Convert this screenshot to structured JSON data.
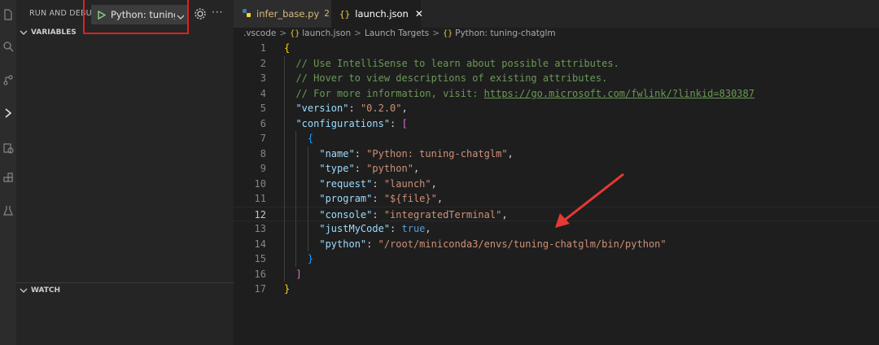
{
  "sidebar": {
    "title": "RUN AND DEBUG",
    "config_label": "Python: tuning-c",
    "sections": {
      "variables": "VARIABLES",
      "watch": "WATCH"
    }
  },
  "tabs": [
    {
      "icon": "python-file-icon",
      "name": "infer_base.py",
      "badge": "2"
    },
    {
      "icon": "json-file-icon",
      "glyph": "{}",
      "name": "launch.json",
      "close": "✕"
    }
  ],
  "breadcrumb": {
    "folder": ".vscode",
    "file": "launch.json",
    "section": "Launch Targets",
    "item": "Python: tuning-chatglm",
    "separator": ">"
  },
  "code": {
    "lines": [
      {
        "n": "1",
        "parts": [
          {
            "t": "{",
            "c": "c-brace"
          }
        ]
      },
      {
        "n": "2",
        "parts": [
          {
            "t": "  // Use IntelliSense to learn about possible attributes.",
            "c": "c-comment"
          }
        ]
      },
      {
        "n": "3",
        "parts": [
          {
            "t": "  // Hover to view descriptions of existing attributes.",
            "c": "c-comment"
          }
        ]
      },
      {
        "n": "4",
        "parts": [
          {
            "t": "  // For more information, visit: ",
            "c": "c-comment"
          },
          {
            "t": "https://go.microsoft.com/fwlink/?linkid=830387",
            "c": "c-link"
          }
        ]
      },
      {
        "n": "5",
        "parts": [
          {
            "t": "  \"version\"",
            "c": "c-key"
          },
          {
            "t": ": ",
            "c": "c-punct"
          },
          {
            "t": "\"0.2.0\"",
            "c": "c-str"
          },
          {
            "t": ",",
            "c": "c-punct"
          }
        ]
      },
      {
        "n": "6",
        "parts": [
          {
            "t": "  \"configurations\"",
            "c": "c-key"
          },
          {
            "t": ": ",
            "c": "c-punct"
          },
          {
            "t": "[",
            "c": "c-bracket"
          }
        ]
      },
      {
        "n": "7",
        "parts": [
          {
            "t": "    ",
            "c": "c-punct"
          },
          {
            "t": "{",
            "c": "c-brace2"
          }
        ]
      },
      {
        "n": "8",
        "parts": [
          {
            "t": "      \"name\"",
            "c": "c-key"
          },
          {
            "t": ": ",
            "c": "c-punct"
          },
          {
            "t": "\"Python: tuning-chatglm\"",
            "c": "c-str"
          },
          {
            "t": ",",
            "c": "c-punct"
          }
        ]
      },
      {
        "n": "9",
        "parts": [
          {
            "t": "      \"type\"",
            "c": "c-key"
          },
          {
            "t": ": ",
            "c": "c-punct"
          },
          {
            "t": "\"python\"",
            "c": "c-str"
          },
          {
            "t": ",",
            "c": "c-punct"
          }
        ]
      },
      {
        "n": "10",
        "parts": [
          {
            "t": "      \"request\"",
            "c": "c-key"
          },
          {
            "t": ": ",
            "c": "c-punct"
          },
          {
            "t": "\"launch\"",
            "c": "c-str"
          },
          {
            "t": ",",
            "c": "c-punct"
          }
        ]
      },
      {
        "n": "11",
        "parts": [
          {
            "t": "      \"program\"",
            "c": "c-key"
          },
          {
            "t": ": ",
            "c": "c-punct"
          },
          {
            "t": "\"${file}\"",
            "c": "c-str"
          },
          {
            "t": ",",
            "c": "c-punct"
          }
        ]
      },
      {
        "n": "12",
        "parts": [
          {
            "t": "      \"console\"",
            "c": "c-key"
          },
          {
            "t": ": ",
            "c": "c-punct"
          },
          {
            "t": "\"integratedTerminal\"",
            "c": "c-str"
          },
          {
            "t": ",",
            "c": "c-punct"
          }
        ]
      },
      {
        "n": "13",
        "parts": [
          {
            "t": "      \"justMyCode\"",
            "c": "c-key"
          },
          {
            "t": ": ",
            "c": "c-punct"
          },
          {
            "t": "true",
            "c": "c-bool"
          },
          {
            "t": ",",
            "c": "c-punct"
          }
        ]
      },
      {
        "n": "14",
        "parts": [
          {
            "t": "      \"python\"",
            "c": "c-key"
          },
          {
            "t": ": ",
            "c": "c-punct"
          },
          {
            "t": "\"/root/miniconda3/envs/tuning-chatglm/bin/python\"",
            "c": "c-str"
          }
        ]
      },
      {
        "n": "15",
        "parts": [
          {
            "t": "    ",
            "c": "c-punct"
          },
          {
            "t": "}",
            "c": "c-brace2"
          }
        ]
      },
      {
        "n": "16",
        "parts": [
          {
            "t": "  ",
            "c": "c-punct"
          },
          {
            "t": "]",
            "c": "c-bracket"
          }
        ]
      },
      {
        "n": "17",
        "parts": [
          {
            "t": "}",
            "c": "c-brace"
          }
        ]
      }
    ],
    "active_line": "12"
  },
  "colors": {
    "accent": "#e02020",
    "annotation_arrow": "#e53935"
  }
}
